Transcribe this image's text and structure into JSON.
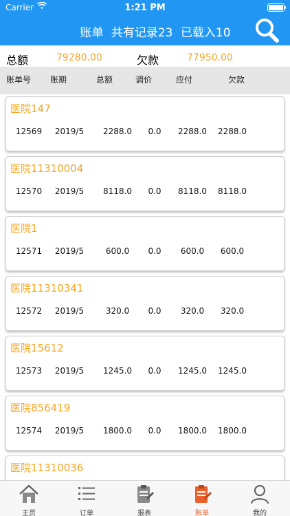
{
  "status": {
    "carrier": "Carrier",
    "time": "1:21 PM"
  },
  "header": {
    "title": "账单",
    "record_text": "共有记录23",
    "loaded_text": "已载入10"
  },
  "summary": {
    "total_label": "总额",
    "total_value": "79280.00",
    "debt_label": "欠款",
    "debt_value": "77950.00"
  },
  "columns": [
    "账单号",
    "账期",
    "总额",
    "调价",
    "应付",
    "欠款"
  ],
  "bills": [
    {
      "name": "医院147",
      "id": "12569",
      "period": "2019/5",
      "total": "2288.0",
      "adjust": "0.0",
      "payable": "2288.0",
      "debt": "2288.0"
    },
    {
      "name": "医院11310004",
      "id": "12570",
      "period": "2019/5",
      "total": "8118.0",
      "adjust": "0.0",
      "payable": "8118.0",
      "debt": "8118.0"
    },
    {
      "name": "医院1",
      "id": "12571",
      "period": "2019/5",
      "total": "600.0",
      "adjust": "0.0",
      "payable": "600.0",
      "debt": "600.0"
    },
    {
      "name": "医院11310341",
      "id": "12572",
      "period": "2019/5",
      "total": "320.0",
      "adjust": "0.0",
      "payable": "320.0",
      "debt": "320.0"
    },
    {
      "name": "医院15612",
      "id": "12573",
      "period": "2019/5",
      "total": "1245.0",
      "adjust": "0.0",
      "payable": "1245.0",
      "debt": "1245.0"
    },
    {
      "name": "医院856419",
      "id": "12574",
      "period": "2019/5",
      "total": "1800.0",
      "adjust": "0.0",
      "payable": "1800.0",
      "debt": "1800.0"
    },
    {
      "name": "医院11310036",
      "id": "",
      "period": "",
      "total": "",
      "adjust": "",
      "payable": "",
      "debt": ""
    }
  ],
  "tabs": [
    {
      "label": "主页",
      "icon": "home-icon"
    },
    {
      "label": "订单",
      "icon": "list-icon"
    },
    {
      "label": "报表",
      "icon": "report-icon"
    },
    {
      "label": "账单",
      "icon": "bill-icon",
      "active": true
    },
    {
      "label": "我的",
      "icon": "user-icon"
    }
  ],
  "colors": {
    "header": "#2196f3",
    "accent": "#f5a623",
    "active_tab": "#e8612c"
  }
}
